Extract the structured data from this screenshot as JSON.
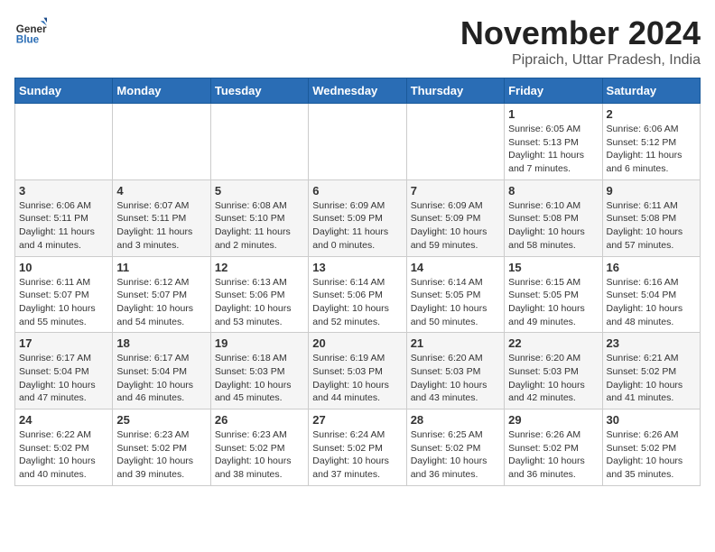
{
  "header": {
    "logo_general": "General",
    "logo_blue": "Blue",
    "title": "November 2024",
    "subtitle": "Pipraich, Uttar Pradesh, India"
  },
  "weekdays": [
    "Sunday",
    "Monday",
    "Tuesday",
    "Wednesday",
    "Thursday",
    "Friday",
    "Saturday"
  ],
  "weeks": [
    [
      {
        "day": "",
        "info": ""
      },
      {
        "day": "",
        "info": ""
      },
      {
        "day": "",
        "info": ""
      },
      {
        "day": "",
        "info": ""
      },
      {
        "day": "",
        "info": ""
      },
      {
        "day": "1",
        "info": "Sunrise: 6:05 AM\nSunset: 5:13 PM\nDaylight: 11 hours and 7 minutes."
      },
      {
        "day": "2",
        "info": "Sunrise: 6:06 AM\nSunset: 5:12 PM\nDaylight: 11 hours and 6 minutes."
      }
    ],
    [
      {
        "day": "3",
        "info": "Sunrise: 6:06 AM\nSunset: 5:11 PM\nDaylight: 11 hours and 4 minutes."
      },
      {
        "day": "4",
        "info": "Sunrise: 6:07 AM\nSunset: 5:11 PM\nDaylight: 11 hours and 3 minutes."
      },
      {
        "day": "5",
        "info": "Sunrise: 6:08 AM\nSunset: 5:10 PM\nDaylight: 11 hours and 2 minutes."
      },
      {
        "day": "6",
        "info": "Sunrise: 6:09 AM\nSunset: 5:09 PM\nDaylight: 11 hours and 0 minutes."
      },
      {
        "day": "7",
        "info": "Sunrise: 6:09 AM\nSunset: 5:09 PM\nDaylight: 10 hours and 59 minutes."
      },
      {
        "day": "8",
        "info": "Sunrise: 6:10 AM\nSunset: 5:08 PM\nDaylight: 10 hours and 58 minutes."
      },
      {
        "day": "9",
        "info": "Sunrise: 6:11 AM\nSunset: 5:08 PM\nDaylight: 10 hours and 57 minutes."
      }
    ],
    [
      {
        "day": "10",
        "info": "Sunrise: 6:11 AM\nSunset: 5:07 PM\nDaylight: 10 hours and 55 minutes."
      },
      {
        "day": "11",
        "info": "Sunrise: 6:12 AM\nSunset: 5:07 PM\nDaylight: 10 hours and 54 minutes."
      },
      {
        "day": "12",
        "info": "Sunrise: 6:13 AM\nSunset: 5:06 PM\nDaylight: 10 hours and 53 minutes."
      },
      {
        "day": "13",
        "info": "Sunrise: 6:14 AM\nSunset: 5:06 PM\nDaylight: 10 hours and 52 minutes."
      },
      {
        "day": "14",
        "info": "Sunrise: 6:14 AM\nSunset: 5:05 PM\nDaylight: 10 hours and 50 minutes."
      },
      {
        "day": "15",
        "info": "Sunrise: 6:15 AM\nSunset: 5:05 PM\nDaylight: 10 hours and 49 minutes."
      },
      {
        "day": "16",
        "info": "Sunrise: 6:16 AM\nSunset: 5:04 PM\nDaylight: 10 hours and 48 minutes."
      }
    ],
    [
      {
        "day": "17",
        "info": "Sunrise: 6:17 AM\nSunset: 5:04 PM\nDaylight: 10 hours and 47 minutes."
      },
      {
        "day": "18",
        "info": "Sunrise: 6:17 AM\nSunset: 5:04 PM\nDaylight: 10 hours and 46 minutes."
      },
      {
        "day": "19",
        "info": "Sunrise: 6:18 AM\nSunset: 5:03 PM\nDaylight: 10 hours and 45 minutes."
      },
      {
        "day": "20",
        "info": "Sunrise: 6:19 AM\nSunset: 5:03 PM\nDaylight: 10 hours and 44 minutes."
      },
      {
        "day": "21",
        "info": "Sunrise: 6:20 AM\nSunset: 5:03 PM\nDaylight: 10 hours and 43 minutes."
      },
      {
        "day": "22",
        "info": "Sunrise: 6:20 AM\nSunset: 5:03 PM\nDaylight: 10 hours and 42 minutes."
      },
      {
        "day": "23",
        "info": "Sunrise: 6:21 AM\nSunset: 5:02 PM\nDaylight: 10 hours and 41 minutes."
      }
    ],
    [
      {
        "day": "24",
        "info": "Sunrise: 6:22 AM\nSunset: 5:02 PM\nDaylight: 10 hours and 40 minutes."
      },
      {
        "day": "25",
        "info": "Sunrise: 6:23 AM\nSunset: 5:02 PM\nDaylight: 10 hours and 39 minutes."
      },
      {
        "day": "26",
        "info": "Sunrise: 6:23 AM\nSunset: 5:02 PM\nDaylight: 10 hours and 38 minutes."
      },
      {
        "day": "27",
        "info": "Sunrise: 6:24 AM\nSunset: 5:02 PM\nDaylight: 10 hours and 37 minutes."
      },
      {
        "day": "28",
        "info": "Sunrise: 6:25 AM\nSunset: 5:02 PM\nDaylight: 10 hours and 36 minutes."
      },
      {
        "day": "29",
        "info": "Sunrise: 6:26 AM\nSunset: 5:02 PM\nDaylight: 10 hours and 36 minutes."
      },
      {
        "day": "30",
        "info": "Sunrise: 6:26 AM\nSunset: 5:02 PM\nDaylight: 10 hours and 35 minutes."
      }
    ]
  ]
}
